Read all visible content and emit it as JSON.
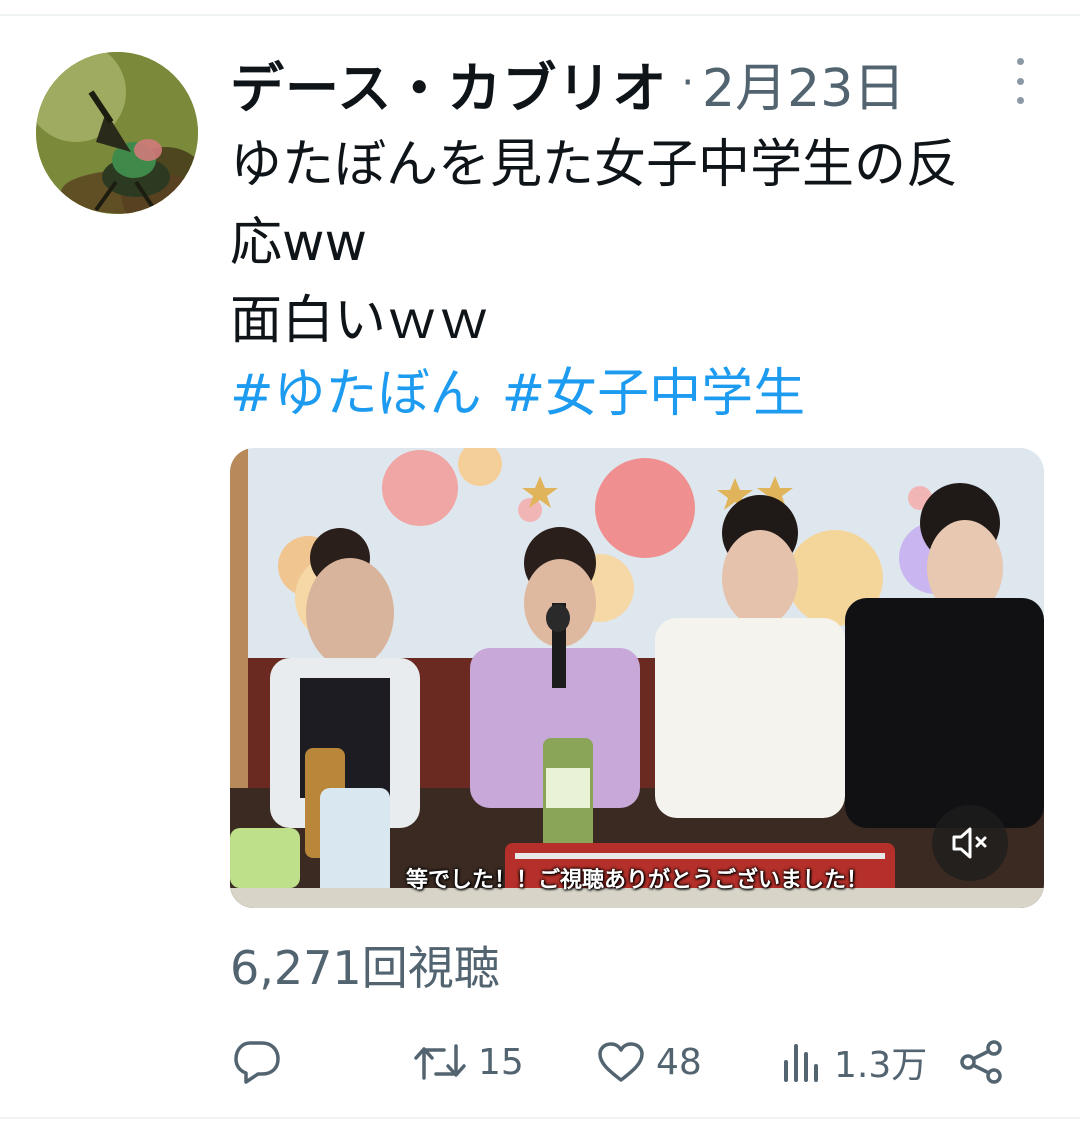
{
  "tweet": {
    "author": "デース・カブリオ",
    "separator": "·",
    "date": "2月23日",
    "text": "ゆたぼんを見た女子中学生の反\n応ww\n面白いｗｗ",
    "hashtags": [
      "#ゆたぼん",
      "#女子中学生"
    ],
    "video": {
      "subtitle": "等でした！！ご視聴ありがとうございました！",
      "muted": true
    },
    "views_label": "6,271回視聴",
    "actions": {
      "reply_icon": "reply-icon",
      "retweet_count": "15",
      "like_count": "48",
      "analytics_count": "1.3万",
      "share_icon": "share-icon"
    }
  },
  "colors": {
    "text": "#0f1419",
    "secondary": "#536471",
    "link": "#1d9bf0"
  }
}
